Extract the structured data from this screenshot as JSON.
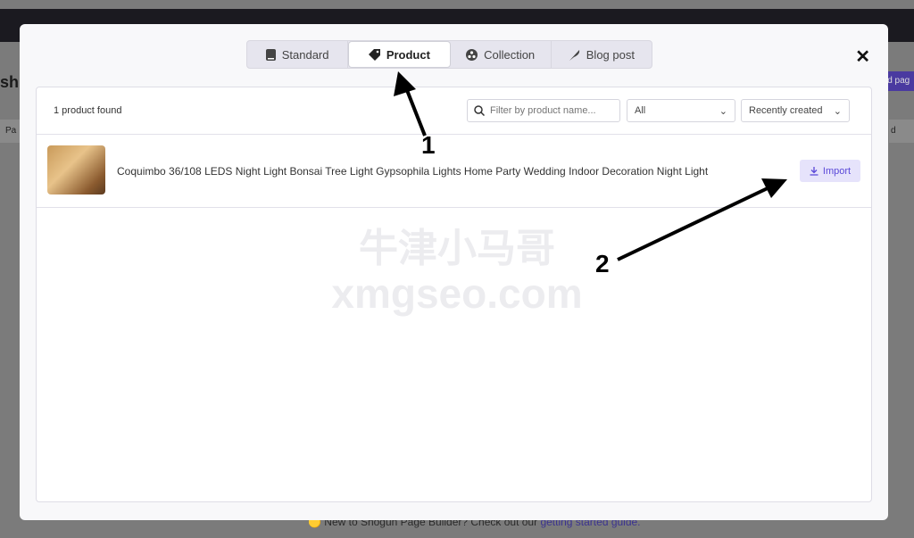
{
  "background": {
    "title_fragment": "sh",
    "button_fragment": "ld pag",
    "left_fragment": "Pa",
    "right_fragment": "d",
    "footer_text": "🟡 New to Shogun Page Builder? Check out our ",
    "footer_link": "getting started guide."
  },
  "modal": {
    "tabs": [
      {
        "label": "Standard",
        "icon": "book-icon"
      },
      {
        "label": "Product",
        "icon": "tag-icon",
        "active": true
      },
      {
        "label": "Collection",
        "icon": "collection-icon"
      },
      {
        "label": "Blog post",
        "icon": "feather-icon"
      }
    ],
    "close_label": "✕",
    "count": "1 product found",
    "filter_placeholder": "Filter by product name...",
    "status_select": "All",
    "sort_select": "Recently created",
    "products": [
      {
        "title": "Coquimbo 36/108 LEDS Night Light Bonsai Tree Light Gypsophila Lights Home Party Wedding Indoor Decoration Night Light",
        "action": "Import"
      }
    ]
  },
  "annotations": {
    "label1": "1",
    "label2": "2"
  },
  "watermark": {
    "line1": "牛津小马哥",
    "line2": "xmgseo.com"
  },
  "colors": {
    "accent": "#5a48d8",
    "import_bg": "#e6e3fb"
  }
}
